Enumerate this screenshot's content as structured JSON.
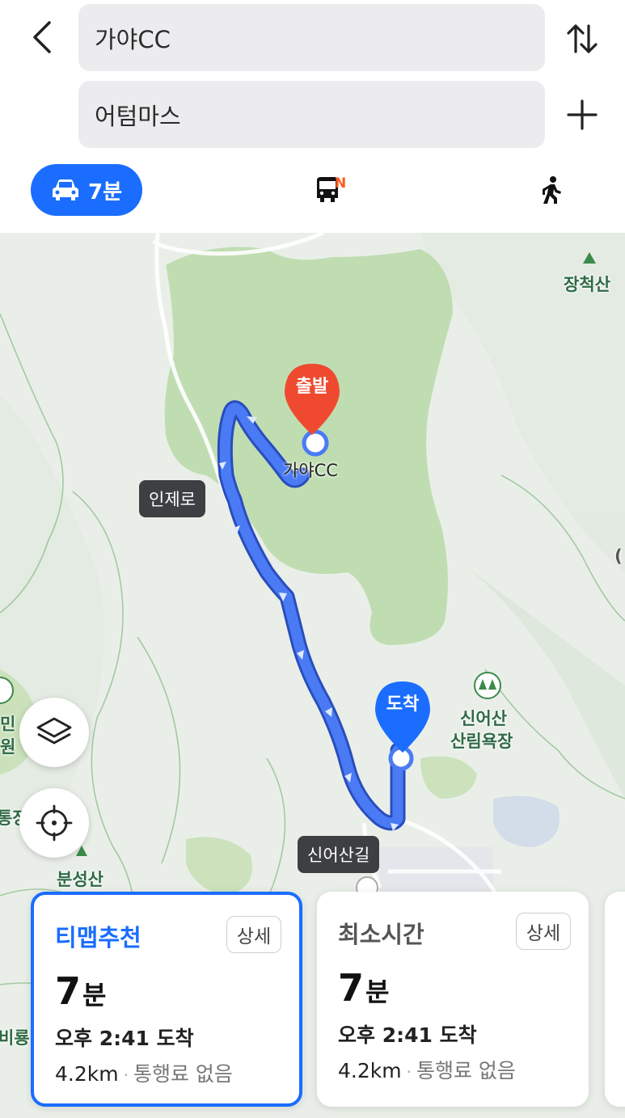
{
  "search": {
    "origin": "가야CC",
    "destination": "어텀마스"
  },
  "modes": {
    "car_label": "7분",
    "bus_badge": "N"
  },
  "map": {
    "labels": {
      "origin_place": "가야CC",
      "mountain_jangcheok": "장척산",
      "forest_line1": "신어산",
      "forest_line2": "산림욕장",
      "mountain_bunseong": "분성산",
      "edge_left1": "민",
      "edge_left2": "원",
      "edge_left3": "통장",
      "edge_left4": "비룡",
      "edge_right": "("
    },
    "road_labels": {
      "inje": "인제로",
      "sineosan": "신어산길"
    },
    "pins": {
      "start": "출발",
      "end": "도착"
    }
  },
  "routes": [
    {
      "title": "티맵추천",
      "detail": "상세",
      "time_value": "7",
      "time_unit": "분",
      "arrival": "오후 2:41 도착",
      "distance": "4.2km",
      "toll": "통행료 없음",
      "selected": true
    },
    {
      "title": "최소시간",
      "detail": "상세",
      "time_value": "7",
      "time_unit": "분",
      "arrival": "오후 2:41 도착",
      "distance": "4.2km",
      "toll": "통행료 없음",
      "selected": false
    }
  ],
  "colors": {
    "accent": "#1a6dff",
    "route": "#3b6cf0",
    "start_pin": "#ef4a30",
    "end_pin": "#1a6dff",
    "park": "#b9d9a8",
    "map_bg": "#e9efe8"
  }
}
